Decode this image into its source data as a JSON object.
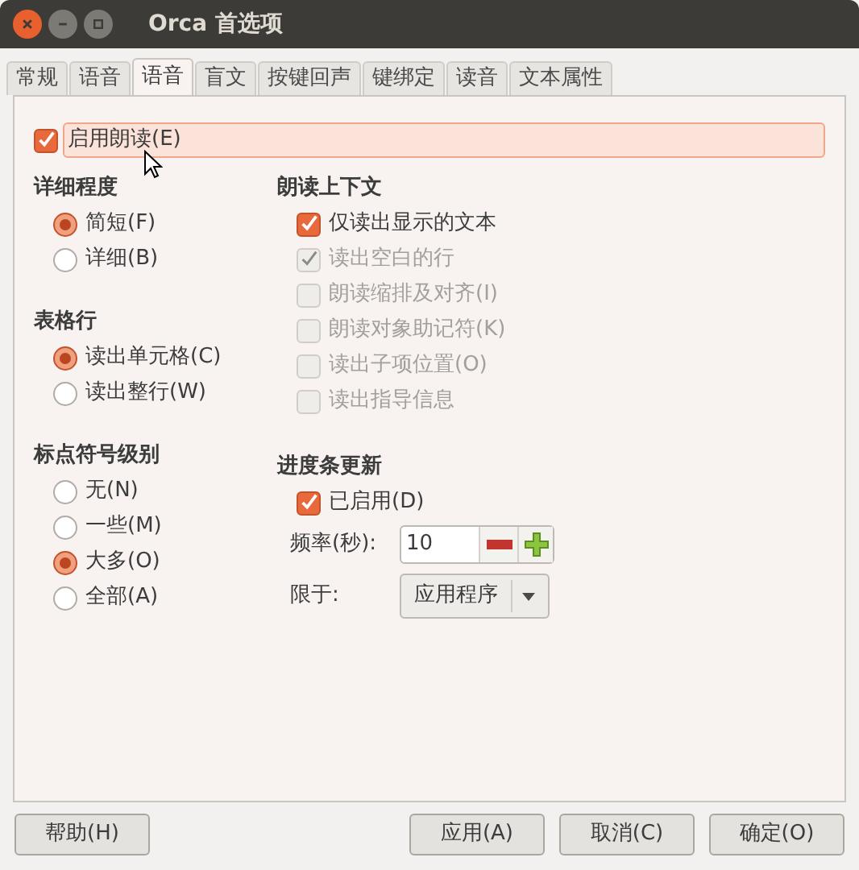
{
  "window": {
    "title": "Orca 首选项"
  },
  "tabs": [
    {
      "label": "常规",
      "selected": false
    },
    {
      "label": "语音",
      "selected": false
    },
    {
      "label": "语音",
      "selected": true
    },
    {
      "label": "盲文",
      "selected": false
    },
    {
      "label": "按键回声",
      "selected": false
    },
    {
      "label": "键绑定",
      "selected": false
    },
    {
      "label": "读音",
      "selected": false
    },
    {
      "label": "文本属性",
      "selected": false
    }
  ],
  "enable_speech": {
    "label": "启用朗读(E)",
    "checked": true,
    "focused": true
  },
  "left_groups": [
    {
      "title": "详细程度",
      "options": [
        {
          "label": "简短(F)",
          "selected": true
        },
        {
          "label": "详细(B)",
          "selected": false
        }
      ]
    },
    {
      "title": "表格行",
      "options": [
        {
          "label": "读出单元格(C)",
          "selected": true
        },
        {
          "label": "读出整行(W)",
          "selected": false
        }
      ]
    },
    {
      "title": "标点符号级别",
      "options": [
        {
          "label": "无(N)",
          "selected": false
        },
        {
          "label": "一些(M)",
          "selected": false
        },
        {
          "label": "大多(O)",
          "selected": true
        },
        {
          "label": "全部(A)",
          "selected": false
        }
      ]
    }
  ],
  "context": {
    "title": "朗读上下文",
    "options": [
      {
        "label": "仅读出显示的文本",
        "checked": true,
        "disabled": false
      },
      {
        "label": "读出空白的行",
        "checked": true,
        "disabled": true
      },
      {
        "label": "朗读缩排及对齐(I)",
        "checked": false,
        "disabled": true
      },
      {
        "label": "朗读对象助记符(K)",
        "checked": false,
        "disabled": true
      },
      {
        "label": "读出子项位置(O)",
        "checked": false,
        "disabled": true
      },
      {
        "label": "读出指导信息",
        "checked": false,
        "disabled": true
      }
    ]
  },
  "progress": {
    "title": "进度条更新",
    "enabled": {
      "label": "已启用(D)",
      "checked": true
    },
    "frequency_label": "频率(秒):",
    "frequency_value": "10",
    "restrict_label": "限于:",
    "restrict_value": "应用程序"
  },
  "buttons_left": [
    "帮助(H)"
  ],
  "buttons_right": [
    "应用(A)",
    "取消(C)",
    "确定(O)"
  ]
}
